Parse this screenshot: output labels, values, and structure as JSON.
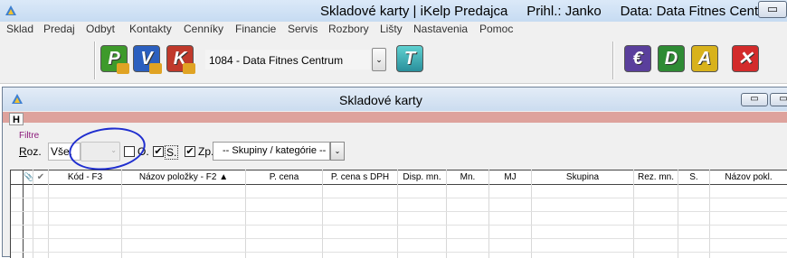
{
  "window": {
    "title": "Skladové karty | iKelp Predajca",
    "user_text": "Prihl.: Janko",
    "data_text": "Data: Data Fitnes Centrum"
  },
  "menu": {
    "items": [
      "Sklad",
      "Predaj",
      "Odbyt",
      "Kontakty",
      "Cenníky",
      "Financie",
      "Servis",
      "Rozbory",
      "Lišty",
      "Nastavenia",
      "Pomoc"
    ]
  },
  "toolbar": {
    "buttons_left": [
      {
        "letter": "P",
        "color": "#3e9a2b"
      },
      {
        "letter": "V",
        "color": "#2b5fbf"
      },
      {
        "letter": "K",
        "color": "#c0392b"
      }
    ],
    "company": "1084 - Data Fitnes Centrum",
    "buttons_right": [
      {
        "letter": "€",
        "color": "#5a3f9c"
      },
      {
        "letter": "D",
        "color": "#2e8b34"
      },
      {
        "letter": "A",
        "color": "#d8b21c"
      },
      {
        "letter": "✕",
        "color": "#d32b2b"
      }
    ]
  },
  "child_window": {
    "title": "Skladové karty",
    "tab_label": "H",
    "pink_bar_color": "#dea29c"
  },
  "filters": {
    "section_label": "Filtre",
    "roz_label": "Roz.",
    "roz_value": "Vše.",
    "o_label": "O.",
    "o_checked": false,
    "s_label": "S.",
    "s_checked": true,
    "zp_label": "Zp.",
    "zp_checked": true,
    "group_select": "-- Skupiny / kategórie --"
  },
  "grid": {
    "columns": [
      "",
      "📎",
      "✔",
      "Kód - F3",
      "Názov položky - F2 ▲",
      "P. cena",
      "P. cena s DPH",
      "Disp. mn.",
      "Mn.",
      "MJ",
      "Skupina",
      "Rez. mn.",
      "S.",
      "Názov pokl."
    ]
  },
  "annotation_color": "#1f2ecf"
}
